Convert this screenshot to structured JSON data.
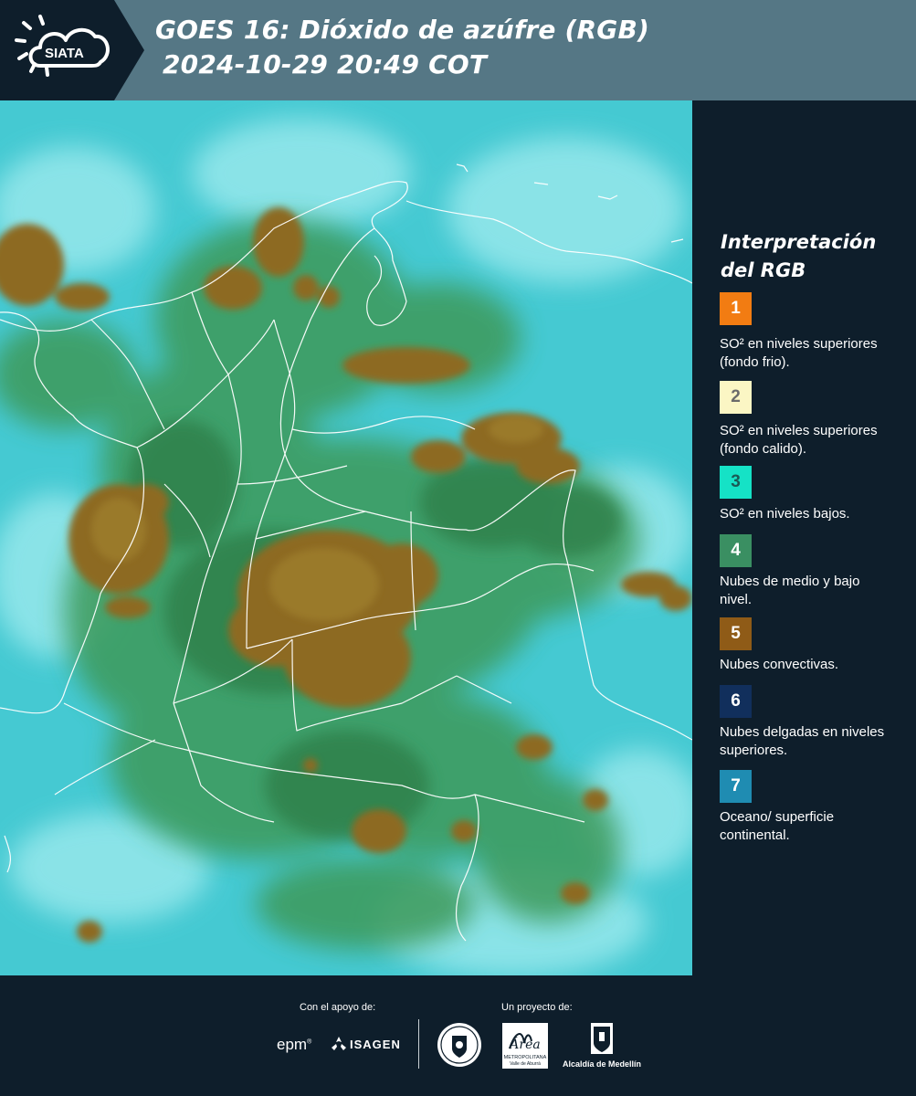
{
  "header": {
    "brand_text": "SIATA",
    "title_line1": "GOES 16: Dióxido de azúfre (RGB)",
    "title_line2": "2024-10-29 20:49 COT"
  },
  "legend": {
    "title_line1": "Interpretación",
    "title_line2": "del RGB",
    "items": [
      {
        "number": "1",
        "color": "#f27c12",
        "text_color": "#ffffff",
        "description": "SO² en niveles superiores (fondo frio)."
      },
      {
        "number": "2",
        "color": "#fbf6c4",
        "text_color": "#6b6b6b",
        "description": "SO² en niveles superiores (fondo calido)."
      },
      {
        "number": "3",
        "color": "#15e2c6",
        "text_color": "#1a5a55",
        "description": "SO² en niveles bajos."
      },
      {
        "number": "4",
        "color": "#3a8f62",
        "text_color": "#ffffff",
        "description": "Nubes de medio y bajo nivel."
      },
      {
        "number": "5",
        "color": "#8f5b17",
        "text_color": "#ffffff",
        "description": "Nubes convectivas."
      },
      {
        "number": "6",
        "color": "#112f5c",
        "text_color": "#ffffff",
        "description": "Nubes delgadas en niveles superiores."
      },
      {
        "number": "7",
        "color": "#1f8cb2",
        "text_color": "#ffffff",
        "description": "Oceano/ superficie continental."
      }
    ]
  },
  "map": {
    "description_colors": {
      "background_cyan": "#45c9d2",
      "light_cyan": "#8fe4e8",
      "green": "#3e9a5a",
      "dark_green": "#2f7f48",
      "brown": "#8b6a25",
      "border_line": "#ffffff"
    }
  },
  "footer": {
    "support_label": "Con el apoyo de:",
    "project_label": "Un proyecto de:",
    "epm_text": "epm",
    "isagen_text": "ISAGEN",
    "area_text": "Área",
    "area_subtext": "METROPOLITANA",
    "area_subtext2": "Valle de Aburrá",
    "alcaldia_text": "Alcaldía de Medellín"
  }
}
